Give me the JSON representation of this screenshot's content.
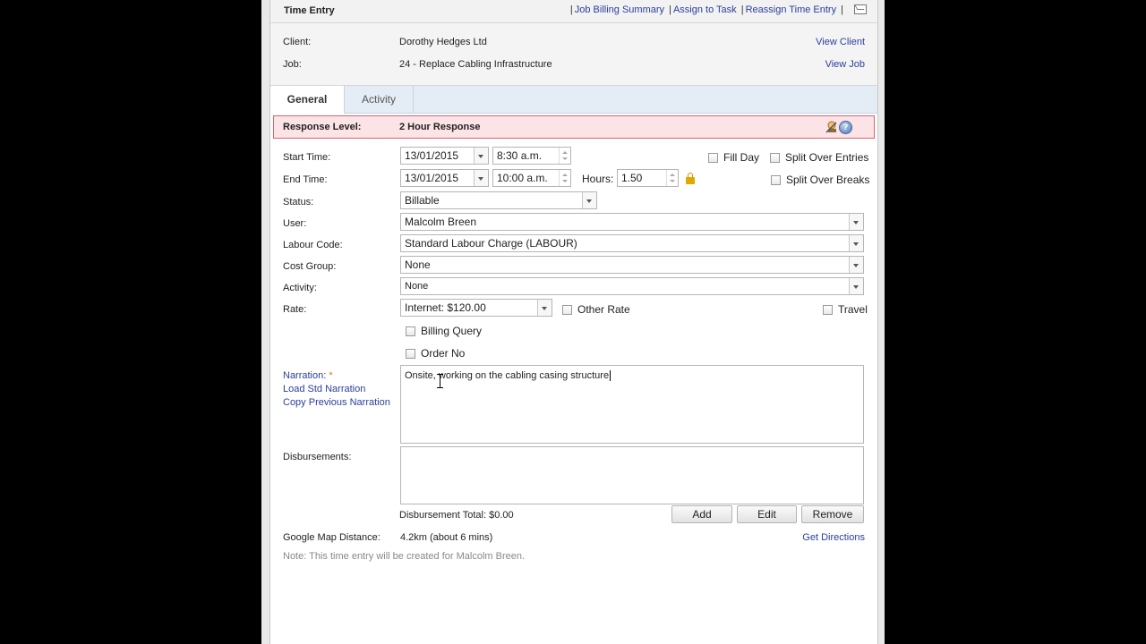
{
  "title": "Time Entry",
  "toplinks": [
    "Job Billing Summary",
    "Assign to Task",
    "Reassign Time Entry"
  ],
  "client": {
    "label": "Client:",
    "value": "Dorothy Hedges Ltd",
    "link": "View Client"
  },
  "job": {
    "label": "Job:",
    "value": "24 - Replace Cabling Infrastructure",
    "link": "View Job"
  },
  "tabs": [
    "General",
    "Activity"
  ],
  "response": {
    "label": "Response Level:",
    "value": "2 Hour Response"
  },
  "form": {
    "start_label": "Start Time:",
    "start_date": "13/01/2015",
    "start_time": "8:30 a.m.",
    "end_label": "End Time:",
    "end_date": "13/01/2015",
    "end_time": "10:00 a.m.",
    "hours_label": "Hours:",
    "hours": "1.50",
    "fill_day": "Fill Day",
    "split_entries": "Split Over Entries",
    "split_breaks": "Split Over Breaks",
    "status_label": "Status:",
    "status": "Billable",
    "user_label": "User:",
    "user": "Malcolm Breen",
    "labour_label": "Labour Code:",
    "labour": "Standard Labour Charge (LABOUR)",
    "costgroup_label": "Cost Group:",
    "costgroup": "None",
    "activity_label": "Activity:",
    "activity": "None",
    "rate_label": "Rate:",
    "rate": "Internet: $120.00",
    "other_rate": "Other Rate",
    "travel": "Travel",
    "billing_query": "Billing Query",
    "order_no": "Order No",
    "narration_label": "Narration:",
    "narration_star": "*",
    "load_std": "Load Std Narration",
    "copy_prev": "Copy Previous Narration",
    "narration": "Onsite, working on the cabling casing structure",
    "disb_label": "Disbursements:",
    "disb_total_label": "Disbursement Total:",
    "disb_total": "$0.00",
    "btn_add": "Add",
    "btn_edit": "Edit",
    "btn_remove": "Remove",
    "map_label": "Google Map Distance:",
    "map_value": "4.2km (about 6 mins)",
    "directions": "Get Directions",
    "note": "Note: This time entry will be created for Malcolm Breen."
  }
}
